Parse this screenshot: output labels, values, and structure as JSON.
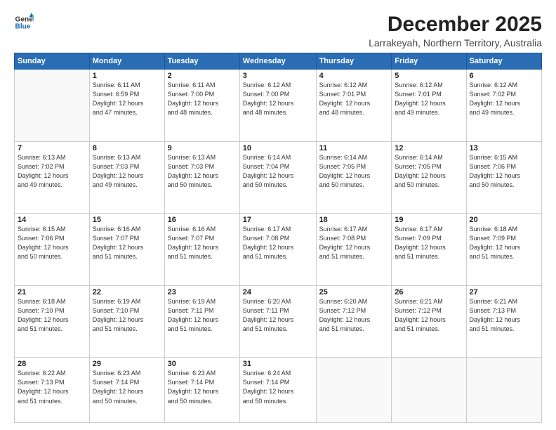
{
  "logo": {
    "line1": "General",
    "line2": "Blue"
  },
  "title": "December 2025",
  "subtitle": "Larrakeyah, Northern Territory, Australia",
  "days_header": [
    "Sunday",
    "Monday",
    "Tuesday",
    "Wednesday",
    "Thursday",
    "Friday",
    "Saturday"
  ],
  "weeks": [
    [
      {
        "num": "",
        "info": ""
      },
      {
        "num": "1",
        "info": "Sunrise: 6:11 AM\nSunset: 6:59 PM\nDaylight: 12 hours\nand 47 minutes."
      },
      {
        "num": "2",
        "info": "Sunrise: 6:11 AM\nSunset: 7:00 PM\nDaylight: 12 hours\nand 48 minutes."
      },
      {
        "num": "3",
        "info": "Sunrise: 6:12 AM\nSunset: 7:00 PM\nDaylight: 12 hours\nand 48 minutes."
      },
      {
        "num": "4",
        "info": "Sunrise: 6:12 AM\nSunset: 7:01 PM\nDaylight: 12 hours\nand 48 minutes."
      },
      {
        "num": "5",
        "info": "Sunrise: 6:12 AM\nSunset: 7:01 PM\nDaylight: 12 hours\nand 49 minutes."
      },
      {
        "num": "6",
        "info": "Sunrise: 6:12 AM\nSunset: 7:02 PM\nDaylight: 12 hours\nand 49 minutes."
      }
    ],
    [
      {
        "num": "7",
        "info": "Sunrise: 6:13 AM\nSunset: 7:02 PM\nDaylight: 12 hours\nand 49 minutes."
      },
      {
        "num": "8",
        "info": "Sunrise: 6:13 AM\nSunset: 7:03 PM\nDaylight: 12 hours\nand 49 minutes."
      },
      {
        "num": "9",
        "info": "Sunrise: 6:13 AM\nSunset: 7:03 PM\nDaylight: 12 hours\nand 50 minutes."
      },
      {
        "num": "10",
        "info": "Sunrise: 6:14 AM\nSunset: 7:04 PM\nDaylight: 12 hours\nand 50 minutes."
      },
      {
        "num": "11",
        "info": "Sunrise: 6:14 AM\nSunset: 7:05 PM\nDaylight: 12 hours\nand 50 minutes."
      },
      {
        "num": "12",
        "info": "Sunrise: 6:14 AM\nSunset: 7:05 PM\nDaylight: 12 hours\nand 50 minutes."
      },
      {
        "num": "13",
        "info": "Sunrise: 6:15 AM\nSunset: 7:06 PM\nDaylight: 12 hours\nand 50 minutes."
      }
    ],
    [
      {
        "num": "14",
        "info": "Sunrise: 6:15 AM\nSunset: 7:06 PM\nDaylight: 12 hours\nand 50 minutes."
      },
      {
        "num": "15",
        "info": "Sunrise: 6:16 AM\nSunset: 7:07 PM\nDaylight: 12 hours\nand 51 minutes."
      },
      {
        "num": "16",
        "info": "Sunrise: 6:16 AM\nSunset: 7:07 PM\nDaylight: 12 hours\nand 51 minutes."
      },
      {
        "num": "17",
        "info": "Sunrise: 6:17 AM\nSunset: 7:08 PM\nDaylight: 12 hours\nand 51 minutes."
      },
      {
        "num": "18",
        "info": "Sunrise: 6:17 AM\nSunset: 7:08 PM\nDaylight: 12 hours\nand 51 minutes."
      },
      {
        "num": "19",
        "info": "Sunrise: 6:17 AM\nSunset: 7:09 PM\nDaylight: 12 hours\nand 51 minutes."
      },
      {
        "num": "20",
        "info": "Sunrise: 6:18 AM\nSunset: 7:09 PM\nDaylight: 12 hours\nand 51 minutes."
      }
    ],
    [
      {
        "num": "21",
        "info": "Sunrise: 6:18 AM\nSunset: 7:10 PM\nDaylight: 12 hours\nand 51 minutes."
      },
      {
        "num": "22",
        "info": "Sunrise: 6:19 AM\nSunset: 7:10 PM\nDaylight: 12 hours\nand 51 minutes."
      },
      {
        "num": "23",
        "info": "Sunrise: 6:19 AM\nSunset: 7:11 PM\nDaylight: 12 hours\nand 51 minutes."
      },
      {
        "num": "24",
        "info": "Sunrise: 6:20 AM\nSunset: 7:11 PM\nDaylight: 12 hours\nand 51 minutes."
      },
      {
        "num": "25",
        "info": "Sunrise: 6:20 AM\nSunset: 7:12 PM\nDaylight: 12 hours\nand 51 minutes."
      },
      {
        "num": "26",
        "info": "Sunrise: 6:21 AM\nSunset: 7:12 PM\nDaylight: 12 hours\nand 51 minutes."
      },
      {
        "num": "27",
        "info": "Sunrise: 6:21 AM\nSunset: 7:13 PM\nDaylight: 12 hours\nand 51 minutes."
      }
    ],
    [
      {
        "num": "28",
        "info": "Sunrise: 6:22 AM\nSunset: 7:13 PM\nDaylight: 12 hours\nand 51 minutes."
      },
      {
        "num": "29",
        "info": "Sunrise: 6:23 AM\nSunset: 7:14 PM\nDaylight: 12 hours\nand 50 minutes."
      },
      {
        "num": "30",
        "info": "Sunrise: 6:23 AM\nSunset: 7:14 PM\nDaylight: 12 hours\nand 50 minutes."
      },
      {
        "num": "31",
        "info": "Sunrise: 6:24 AM\nSunset: 7:14 PM\nDaylight: 12 hours\nand 50 minutes."
      },
      {
        "num": "",
        "info": ""
      },
      {
        "num": "",
        "info": ""
      },
      {
        "num": "",
        "info": ""
      }
    ]
  ]
}
